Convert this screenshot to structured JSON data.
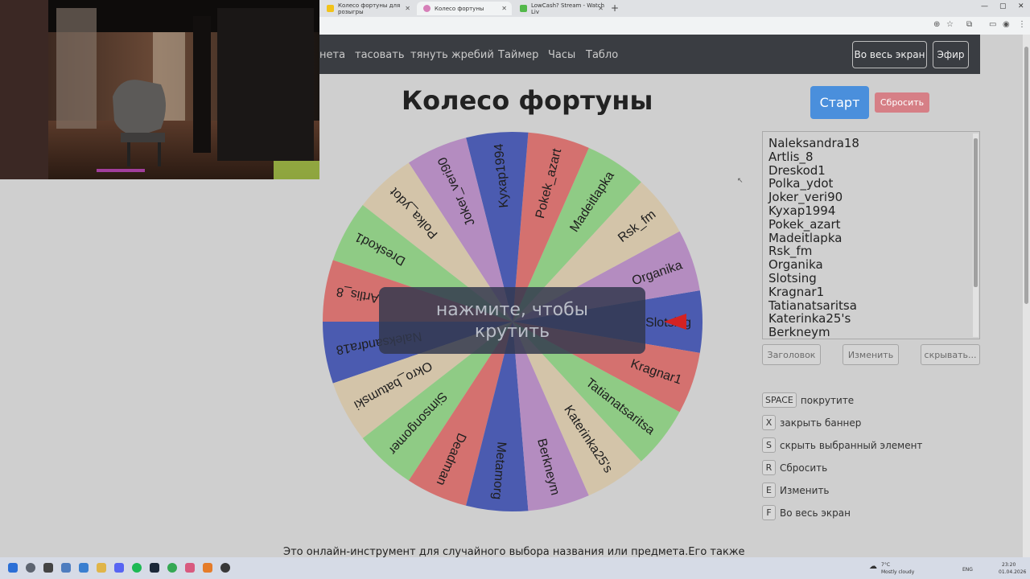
{
  "browser": {
    "tabs": [
      {
        "label": "Колесо фортуны для розыгры"
      },
      {
        "label": "Колесо фортуны"
      },
      {
        "label": "LowCash? Stream - Watch Liv"
      }
    ]
  },
  "nav": {
    "links": [
      "нета",
      "тасовать",
      "тянуть жребий",
      "Таймер",
      "Часы",
      "Табло"
    ],
    "fullscreen_label": "Во весь экран",
    "air_label": "Эфир"
  },
  "main": {
    "title": "Колесо фортуны",
    "start_label": "Старт",
    "reset_label": "Сбросить",
    "banner_text": "нажмите, чтобы крутить"
  },
  "wheel": {
    "segments": [
      "Slotsing",
      "Organika",
      "Rsk_fm",
      "Madeitlapka",
      "Pokek_azart",
      "Kyxap1994",
      "Joker_veri90",
      "Polka_ydot",
      "Dreskod1",
      "Artlis_8",
      "Naleksandra18",
      "Okro_batumski",
      "Simsongomer",
      "Deadman",
      "Metamorg",
      "Berkneym",
      "Katerinka25's",
      "Tatianatsaritsa",
      "Kragnar1"
    ],
    "colors": [
      "#4b5bb0",
      "#b48cc0",
      "#d3c4a9",
      "#8fcb85",
      "#d4716f",
      "#4b5bb0",
      "#b48cc0",
      "#d3c4a9",
      "#8fcb85",
      "#d4716f",
      "#4b5bb0",
      "#d3c4a9",
      "#8fcb85",
      "#d4716f",
      "#4b5bb0",
      "#b48cc0",
      "#d3c4a9",
      "#8fcb85",
      "#d4716f"
    ],
    "pointer_color": "#d42222"
  },
  "names_list": [
    "Naleksandra18",
    "Artlis_8",
    "Dreskod1",
    "Polka_ydot",
    "Joker_veri90",
    "Kyxap1994",
    "Pokek_azart",
    "Madeitlapka",
    "Rsk_fm",
    "Organika",
    "Slotsing",
    "Kragnar1",
    "Tatianatsaritsa",
    "Katerinka25's",
    "Berkneym"
  ],
  "list_buttons": {
    "header": "Заголовок",
    "edit": "Изменить",
    "hide": "скрывать..."
  },
  "hotkeys": [
    {
      "key": "SPACE",
      "desc": "покрутите"
    },
    {
      "key": "X",
      "desc": "закрыть баннер"
    },
    {
      "key": "S",
      "desc": "скрыть выбранный элемент"
    },
    {
      "key": "R",
      "desc": "Сбросить"
    },
    {
      "key": "E",
      "desc": "Изменить"
    },
    {
      "key": "F",
      "desc": "Во весь экран"
    }
  ],
  "footer_text": "Это онлайн-инструмент для случайного выбора названия или предмета.Его также",
  "taskbar": {
    "weather_temp": "7°C",
    "weather_desc": "Mostly cloudy",
    "lang": "ENG",
    "time": "23:20",
    "date": "01.04.2026"
  }
}
